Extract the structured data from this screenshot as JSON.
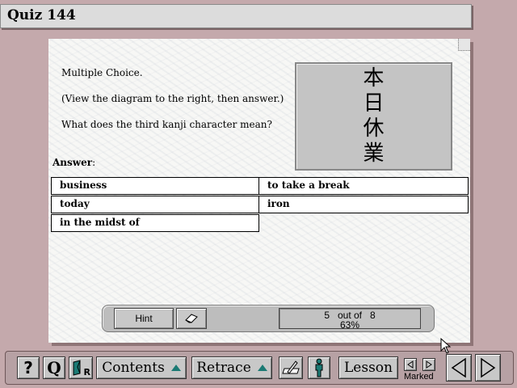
{
  "window": {
    "title": "Quiz 144"
  },
  "question": {
    "type": "Multiple Choice.",
    "instruction": "(View the diagram to the right, then answer.)",
    "prompt": "What does the third kanji character mean?",
    "kanji": [
      "本",
      "日",
      "休",
      "業"
    ]
  },
  "answer": {
    "label": "Answer",
    "colon": ":",
    "options": [
      "business",
      "to take a break",
      "today",
      "iron",
      "in the midst of"
    ]
  },
  "status": {
    "hint_label": "Hint",
    "score_line1": "5   out of   8",
    "score_line2": "63%",
    "correct": 5,
    "total": 8,
    "percent": 63
  },
  "toolbar": {
    "help": "?",
    "quiz": "Q",
    "reader_letter": "R",
    "contents": "Contents",
    "retrace": "Retrace",
    "lesson": "Lesson",
    "marked": "Marked"
  },
  "colors": {
    "accent_teal": "#1b7a74",
    "background": "#c4a9ac",
    "paper": "#f7f7f5"
  }
}
